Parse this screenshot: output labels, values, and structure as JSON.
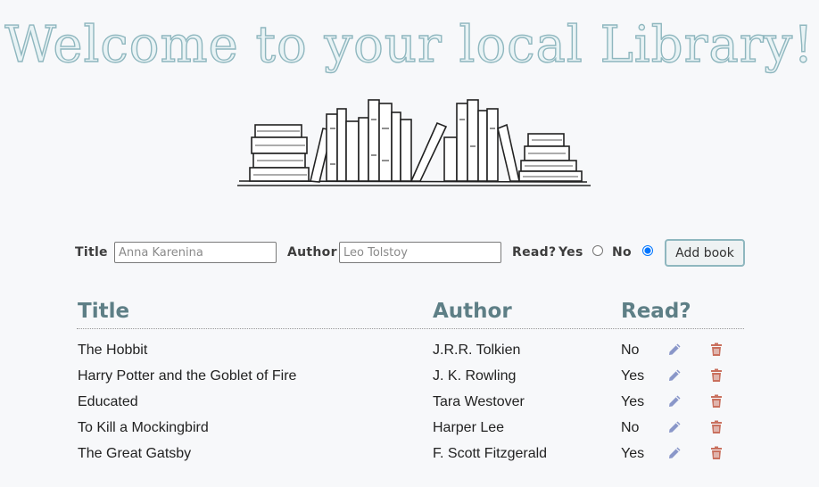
{
  "header": {
    "title": "Welcome to your local Library!"
  },
  "form": {
    "title_label": "Title",
    "title_placeholder": "Anna Karenina",
    "author_label": "Author",
    "author_placeholder": "Leo Tolstoy",
    "read_label": "Read?",
    "yes_label": "Yes",
    "no_label": "No",
    "selected": "No",
    "add_button": "Add book"
  },
  "table": {
    "headers": {
      "title": "Title",
      "author": "Author",
      "read": "Read?"
    },
    "rows": [
      {
        "title": "The Hobbit",
        "author": "J.R.R. Tolkien",
        "read": "No"
      },
      {
        "title": "Harry Potter and the Goblet of Fire",
        "author": "J. K. Rowling",
        "read": "Yes"
      },
      {
        "title": "Educated",
        "author": "Tara Westover",
        "read": "Yes"
      },
      {
        "title": "To Kill a Mockingbird",
        "author": "Harper Lee",
        "read": "No"
      },
      {
        "title": "The Great Gatsby",
        "author": "F. Scott Fitzgerald",
        "read": "Yes"
      }
    ]
  },
  "icons": {
    "edit": "pencil-icon",
    "delete": "trash-icon"
  },
  "colors": {
    "title_fill": "#e9f3f5",
    "title_stroke": "#8fb7bf",
    "header_text": "#5e7f86",
    "edit_icon": "#8a97c9",
    "delete_icon": "#c9705e",
    "button_border": "#8fb7bf"
  }
}
